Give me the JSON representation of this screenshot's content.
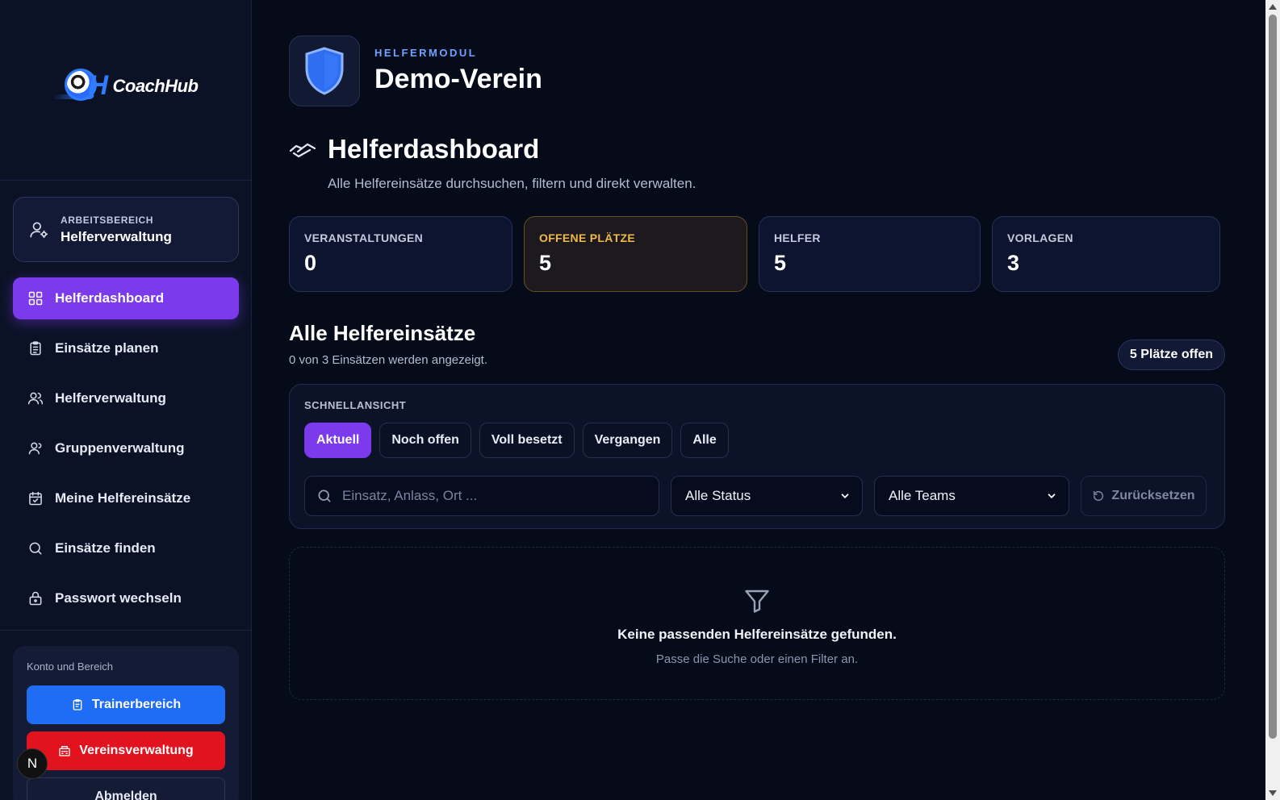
{
  "app": {
    "logo_text": "CoachHub"
  },
  "sidebar": {
    "workspace": {
      "label": "ARBEITSBEREICH",
      "value": "Helferverwaltung"
    },
    "items": [
      {
        "label": "Helferdashboard",
        "icon": "grid-icon",
        "active": true
      },
      {
        "label": "Einsätze planen",
        "icon": "clipboard-icon",
        "active": false
      },
      {
        "label": "Helferverwaltung",
        "icon": "users-icon",
        "active": false
      },
      {
        "label": "Gruppenverwaltung",
        "icon": "user-group-icon",
        "active": false
      },
      {
        "label": "Meine Helfereinsätze",
        "icon": "calendar-icon",
        "active": false
      },
      {
        "label": "Einsätze finden",
        "icon": "search-icon",
        "active": false
      },
      {
        "label": "Passwort wechseln",
        "icon": "lock-icon",
        "active": false
      }
    ],
    "account": {
      "label": "Konto und Bereich",
      "trainer_button": "Trainerbereich",
      "club_button": "Vereinsverwaltung",
      "logout_button": "Abmelden",
      "avatar_initial": "N"
    }
  },
  "header": {
    "kicker": "HELFERMODUL",
    "club_name": "Demo-Verein"
  },
  "page": {
    "title": "Helferdashboard",
    "subtitle": "Alle Helfereinsätze durchsuchen, filtern und direkt verwalten."
  },
  "stats": [
    {
      "label": "VERANSTALTUNGEN",
      "value": "0"
    },
    {
      "label": "OFFENE PLÄTZE",
      "value": "5"
    },
    {
      "label": "HELFER",
      "value": "5"
    },
    {
      "label": "VORLAGEN",
      "value": "3"
    }
  ],
  "section": {
    "title": "Alle Helfereinsätze",
    "subtitle": "0 von 3 Einsätzen werden angezeigt.",
    "open_pill": "5 Plätze offen"
  },
  "filters": {
    "quick_label": "SCHNELLANSICHT",
    "chips": [
      "Aktuell",
      "Noch offen",
      "Voll besetzt",
      "Vergangen",
      "Alle"
    ],
    "active_chip": "Aktuell",
    "search_placeholder": "Einsatz, Anlass, Ort ...",
    "status_value": "Alle Status",
    "team_value": "Alle Teams",
    "reset_label": "Zurücksetzen"
  },
  "empty": {
    "title": "Keine passenden Helfereinsätze gefunden.",
    "subtitle": "Passe die Suche oder einen Filter an."
  },
  "colors": {
    "accent": "#7c3aed",
    "blue": "#1f6cf5",
    "red": "#e3121f",
    "warning": "#f2b94a"
  }
}
